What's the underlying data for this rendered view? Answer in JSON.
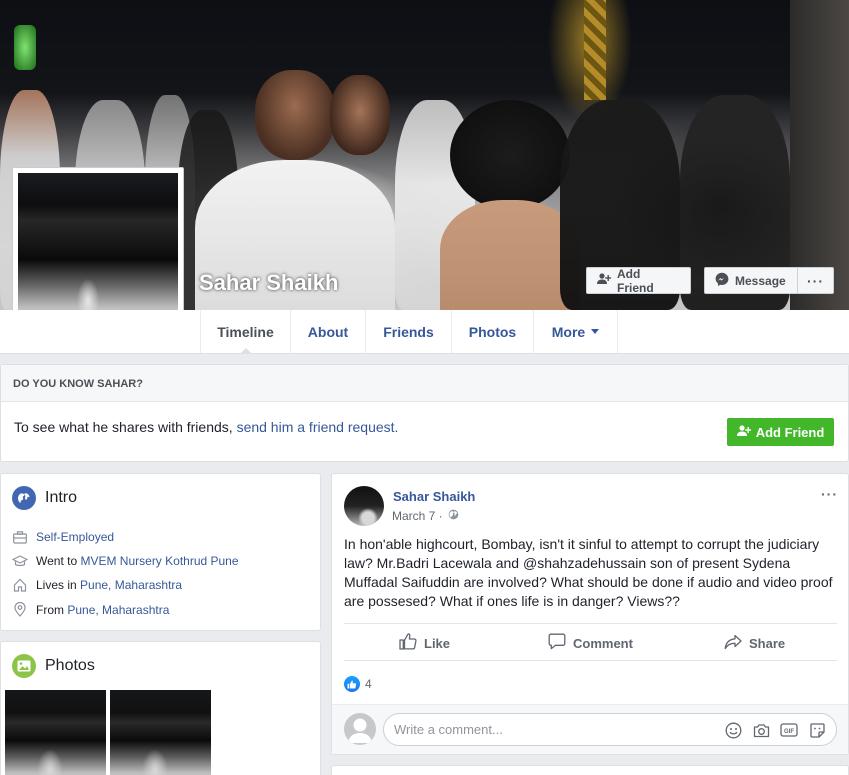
{
  "profile": {
    "name": "Sahar Shaikh",
    "add_friend_label": "Add Friend",
    "message_label": "Message",
    "more_label": "···"
  },
  "tabs": [
    {
      "label": "Timeline",
      "active": true
    },
    {
      "label": "About"
    },
    {
      "label": "Friends"
    },
    {
      "label": "Photos"
    },
    {
      "label": "More"
    }
  ],
  "know_box": {
    "header": "DO YOU KNOW SAHAR?",
    "text_prefix": "To see what he shares with friends, ",
    "link_text": "send him a friend request.",
    "button_label": "Add Friend"
  },
  "intro": {
    "title": "Intro",
    "items": [
      {
        "icon": "briefcase-icon",
        "prefix": "",
        "link": "Self-Employed"
      },
      {
        "icon": "graduation-cap-icon",
        "prefix": "Went to ",
        "link": "MVEM Nursery Kothrud Pune"
      },
      {
        "icon": "home-icon",
        "prefix": "Lives in ",
        "link": "Pune, Maharashtra"
      },
      {
        "icon": "location-pin-icon",
        "prefix": "From ",
        "link": "Pune, Maharashtra"
      }
    ]
  },
  "photos": {
    "title": "Photos"
  },
  "post": {
    "author": "Sahar Shaikh",
    "date": "March 7 ·",
    "options": "···",
    "text": "In hon'able highcourt, Bombay, isn't it sinful to attempt to corrupt the judiciary law? Mr.Badri Lacewala and @shahzadehussain son of present Sydena Muffadal Saifuddin are involved? What should be done if audio and video proof are possesed? What if ones life is in danger? Views??",
    "actions": {
      "like": "Like",
      "comment": "Comment",
      "share": "Share"
    },
    "reaction_count": "4",
    "comment_placeholder": "Write a comment..."
  },
  "colors": {
    "link_blue": "#365899",
    "fb_green": "#42b72a",
    "background": "#e9ebee"
  }
}
